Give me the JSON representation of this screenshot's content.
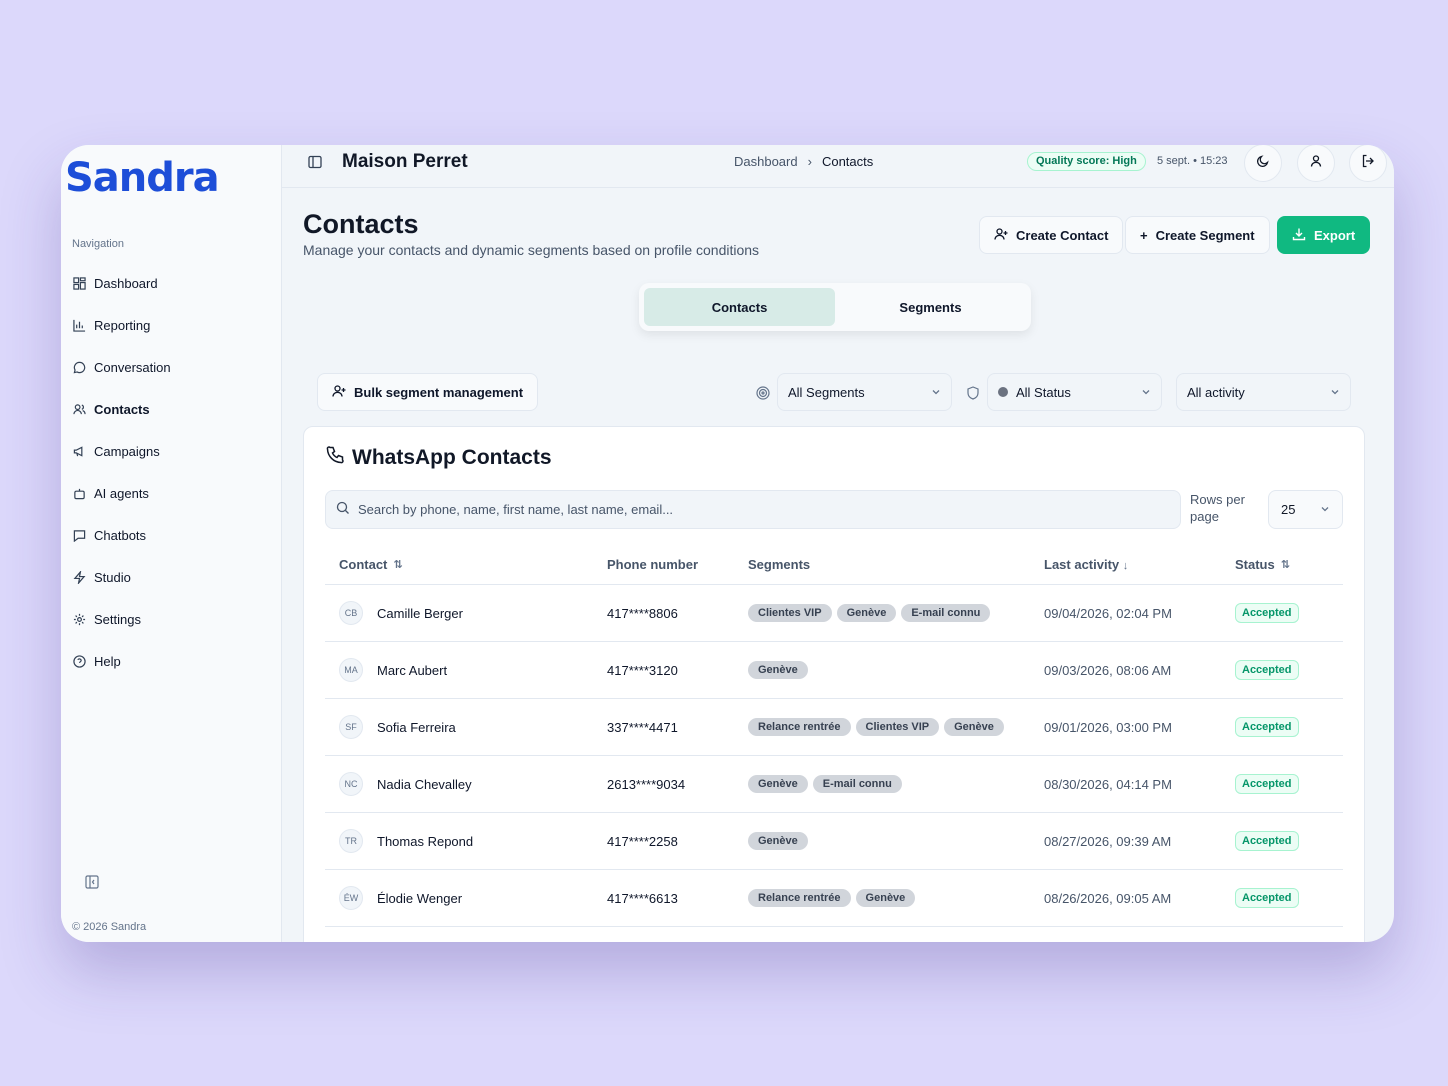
{
  "app": {
    "logo": "Sandra",
    "copyright": "© 2026 Sandra"
  },
  "sidebar": {
    "heading": "Navigation",
    "items": [
      {
        "label": "Dashboard",
        "icon": "grid-icon"
      },
      {
        "label": "Reporting",
        "icon": "bar-chart-icon"
      },
      {
        "label": "Conversation",
        "icon": "chat-bubble-icon"
      },
      {
        "label": "Contacts",
        "icon": "users-icon"
      },
      {
        "label": "Campaigns",
        "icon": "megaphone-icon"
      },
      {
        "label": "AI agents",
        "icon": "bot-icon"
      },
      {
        "label": "Chatbots",
        "icon": "message-square-icon"
      },
      {
        "label": "Studio",
        "icon": "bolt-icon"
      },
      {
        "label": "Settings",
        "icon": "gear-icon"
      },
      {
        "label": "Help",
        "icon": "help-circle-icon"
      }
    ],
    "active": "Contacts"
  },
  "header": {
    "org_name": "Maison Perret",
    "breadcrumb": [
      "Dashboard",
      "Contacts"
    ],
    "quality_badge": "Quality score: High",
    "datetime": "5 sept. • 15:23"
  },
  "page": {
    "title": "Contacts",
    "subtitle": "Manage your contacts and dynamic segments based on profile conditions",
    "buttons": {
      "create_contact": "Create Contact",
      "create_segment": "Create Segment",
      "export": "Export"
    },
    "tabs": [
      "Contacts",
      "Segments"
    ],
    "active_tab": "Contacts"
  },
  "filters": {
    "bulk_label": "Bulk segment management",
    "segments": "All Segments",
    "status": "All Status",
    "activity": "All activity"
  },
  "card": {
    "title": "WhatsApp Contacts",
    "search_placeholder": "Search by phone, name, first name, last name, email...",
    "rows_per_page_label": "Rows per page",
    "rows_per_page": "25"
  },
  "table": {
    "columns": [
      "Contact",
      "Phone number",
      "Segments",
      "Last activity",
      "Status"
    ],
    "rows": [
      {
        "initials": "CB",
        "name": "Camille Berger",
        "phone": "417****8806",
        "segments": [
          "Clientes VIP",
          "Genève",
          "E-mail connu"
        ],
        "last_activity": "09/04/2026, 02:04 PM",
        "status": "Accepted"
      },
      {
        "initials": "MA",
        "name": "Marc Aubert",
        "phone": "417****3120",
        "segments": [
          "Genève"
        ],
        "last_activity": "09/03/2026, 08:06 AM",
        "status": "Accepted"
      },
      {
        "initials": "SF",
        "name": "Sofia Ferreira",
        "phone": "337****4471",
        "segments": [
          "Relance rentrée",
          "Clientes VIP",
          "Genève"
        ],
        "last_activity": "09/01/2026, 03:00 PM",
        "status": "Accepted"
      },
      {
        "initials": "NC",
        "name": "Nadia Chevalley",
        "phone": "2613****9034",
        "segments": [
          "Genève",
          "E-mail connu"
        ],
        "last_activity": "08/30/2026, 04:14 PM",
        "status": "Accepted"
      },
      {
        "initials": "TR",
        "name": "Thomas Repond",
        "phone": "417****2258",
        "segments": [
          "Genève"
        ],
        "last_activity": "08/27/2026, 09:39 AM",
        "status": "Accepted"
      },
      {
        "initials": "ÉW",
        "name": "Élodie Wenger",
        "phone": "417****6613",
        "segments": [
          "Relance rentrée",
          "Genève"
        ],
        "last_activity": "08/26/2026, 09:05 AM",
        "status": "Accepted"
      }
    ]
  },
  "colors": {
    "brand": "#1d4ed8",
    "accent": "#10b981",
    "background": "#dcd8fb"
  }
}
